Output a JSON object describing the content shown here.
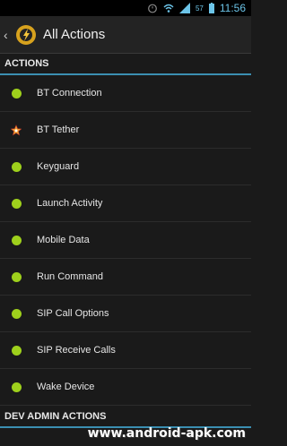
{
  "status_bar": {
    "battery_level": "57",
    "time": "11:56"
  },
  "header": {
    "title": "All Actions"
  },
  "sections": [
    {
      "label": "ACTIONS",
      "items": [
        {
          "label": "BT Connection",
          "icon": "green-dot-icon"
        },
        {
          "label": "BT Tether",
          "icon": "star-icon"
        },
        {
          "label": "Keyguard",
          "icon": "green-dot-icon"
        },
        {
          "label": "Launch Activity",
          "icon": "green-dot-icon"
        },
        {
          "label": "Mobile Data",
          "icon": "green-dot-icon"
        },
        {
          "label": "Run Command",
          "icon": "green-dot-icon"
        },
        {
          "label": "SIP Call Options",
          "icon": "green-dot-icon"
        },
        {
          "label": "SIP Receive Calls",
          "icon": "green-dot-icon"
        },
        {
          "label": "Wake Device",
          "icon": "green-dot-icon"
        }
      ]
    },
    {
      "label": "DEV ADMIN ACTIONS",
      "items": []
    }
  ],
  "watermark": "www.android-apk.com",
  "colors": {
    "accent": "#3b8fb2",
    "dot": "#9ed01c",
    "star": "#f0a030"
  }
}
